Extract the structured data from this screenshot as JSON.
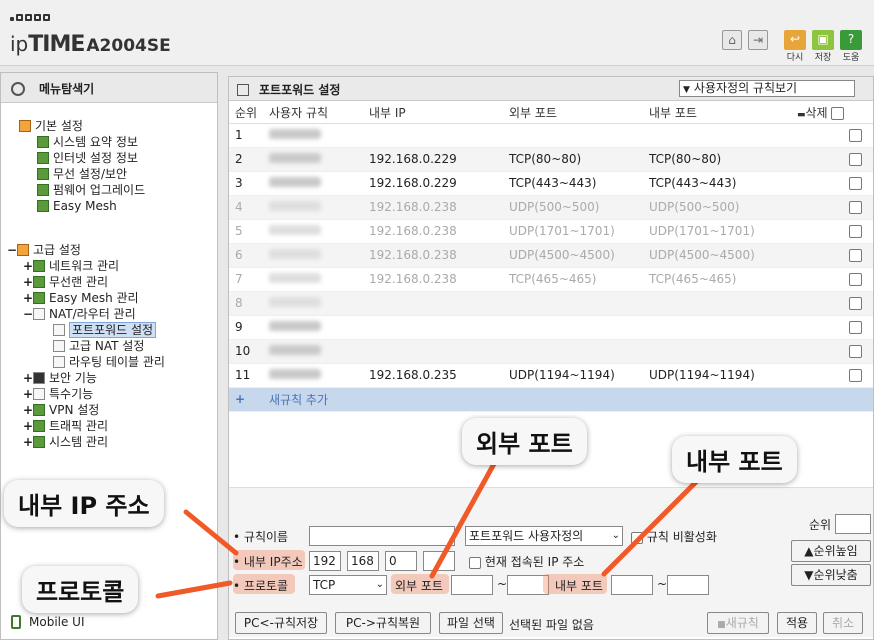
{
  "header": {
    "brand_ip": "ip",
    "brand_time": "TIME",
    "model": "A2004SE",
    "buttons": {
      "restart": "다시",
      "save": "저장",
      "help": "도움"
    }
  },
  "sidebar": {
    "title": "메뉴탐색기",
    "basic": {
      "label": "기본 설정",
      "items": [
        "시스템 요약 정보",
        "인터넷 설정 정보",
        "무선 설정/보안",
        "펌웨어 업그레이드",
        "Easy Mesh"
      ]
    },
    "advanced": {
      "label": "고급 설정",
      "items": [
        "네트워크 관리",
        "무선랜 관리",
        "Easy Mesh 관리",
        "NAT/라우터 관리"
      ],
      "nat_children": [
        "포트포워드 설정",
        "고급 NAT 설정",
        "라우팅 테이블 관리"
      ],
      "items2": [
        "보안 기능",
        "특수기능",
        "VPN 설정",
        "트래픽 관리",
        "시스템 관리"
      ]
    },
    "mobile_ui": "Mobile UI"
  },
  "main": {
    "title": "포트포워드 설정",
    "view_select": "사용자정의 규칙보기",
    "columns": {
      "num": "순위",
      "name": "사용자 규칙",
      "inner_ip": "내부 IP",
      "outer_port": "외부 포트",
      "inner_port": "내부 포트",
      "delete": "삭제"
    },
    "rows": [
      {
        "num": "1",
        "ip": "",
        "outer": "",
        "inner": "",
        "disabled": false
      },
      {
        "num": "2",
        "ip": "192.168.0.229",
        "outer": "TCP(80~80)",
        "inner": "TCP(80~80)",
        "disabled": false
      },
      {
        "num": "3",
        "ip": "192.168.0.229",
        "outer": "TCP(443~443)",
        "inner": "TCP(443~443)",
        "disabled": false
      },
      {
        "num": "4",
        "ip": "192.168.0.238",
        "outer": "UDP(500~500)",
        "inner": "UDP(500~500)",
        "disabled": true
      },
      {
        "num": "5",
        "ip": "192.168.0.238",
        "outer": "UDP(1701~1701)",
        "inner": "UDP(1701~1701)",
        "disabled": true
      },
      {
        "num": "6",
        "ip": "192.168.0.238",
        "outer": "UDP(4500~4500)",
        "inner": "UDP(4500~4500)",
        "disabled": true
      },
      {
        "num": "7",
        "ip": "192.168.0.238",
        "outer": "TCP(465~465)",
        "inner": "TCP(465~465)",
        "disabled": true
      },
      {
        "num": "8",
        "ip": "",
        "outer": "",
        "inner": "",
        "disabled": true
      },
      {
        "num": "9",
        "ip": "",
        "outer": "",
        "inner": "",
        "disabled": false
      },
      {
        "num": "10",
        "ip": "",
        "outer": "",
        "inner": "",
        "disabled": false
      },
      {
        "num": "11",
        "ip": "192.168.0.235",
        "outer": "UDP(1194~1194)",
        "inner": "UDP(1194~1194)",
        "disabled": false
      }
    ],
    "new_rule": "새규칙 추가"
  },
  "form": {
    "rule_name_label": "규칙이름",
    "rule_type": "포트포워드 사용자정의",
    "disable_label": "규칙 비활성화",
    "inner_ip_label": "내부 IP주소",
    "ip": [
      "192",
      "168",
      "0",
      ""
    ],
    "current_ip_label": "현재 접속된 IP 주소",
    "protocol_label": "프로토콜",
    "protocol": "TCP",
    "outer_port_label": "외부 포트",
    "inner_port_label": "내부 포트",
    "tilde": "~",
    "rank_label": "순위",
    "rank_up": "순위높임",
    "rank_down": "순위낮춤",
    "pc_save": "PC<-규칙저장",
    "pc_restore": "PC->규칙복원",
    "file_select": "파일 선택",
    "no_file": "선택된 파일 없음",
    "new_rule_btn": "새규칙",
    "apply": "적용",
    "cancel": "취소"
  },
  "callouts": {
    "outer_port": "외부 포트",
    "inner_port": "내부 포트",
    "inner_ip": "내부 IP 주소",
    "protocol": "프로토콜"
  },
  "colors": {
    "accent": "#f05a28",
    "new_rule_bg": "#c7d7ec"
  }
}
